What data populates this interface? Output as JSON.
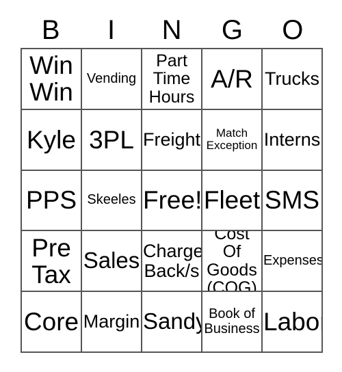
{
  "card": {
    "title": "BINGO Card",
    "header_letters": [
      "B",
      "I",
      "N",
      "G",
      "O"
    ],
    "grid_size": "5x5",
    "border_color": "#555555",
    "text_color": "#000000",
    "background_color": "#ffffff",
    "rows": [
      [
        {
          "text": "Win\nWin",
          "size": "sz-xl"
        },
        {
          "text": "Vending",
          "size": "sz-xs"
        },
        {
          "text": "Part\nTime\nHours",
          "size": "sz-sm"
        },
        {
          "text": "A/R",
          "size": "sz-xl"
        },
        {
          "text": "Trucks",
          "size": "sz-md"
        }
      ],
      [
        {
          "text": "Kyle",
          "size": "sz-xl"
        },
        {
          "text": "3PL",
          "size": "sz-xl"
        },
        {
          "text": "Freight",
          "size": "sz-md"
        },
        {
          "text": "Match\nException",
          "size": "sz-xxs"
        },
        {
          "text": "Interns",
          "size": "sz-md"
        }
      ],
      [
        {
          "text": "PPS",
          "size": "sz-xl"
        },
        {
          "text": "Skeeles",
          "size": "sz-xs"
        },
        {
          "text": "Free!",
          "size": "sz-xl"
        },
        {
          "text": "Fleet",
          "size": "sz-xl"
        },
        {
          "text": "SMS",
          "size": "sz-xl"
        }
      ],
      [
        {
          "text": "Pre\nTax",
          "size": "sz-xl"
        },
        {
          "text": "Sales",
          "size": "sz-lg"
        },
        {
          "text": "Charge\nBack/s",
          "size": "sz-md"
        },
        {
          "text": "Cost Of\nGoods\n(COG)",
          "size": "sz-sm"
        },
        {
          "text": "Expenses",
          "size": "sz-xs"
        }
      ],
      [
        {
          "text": "Core",
          "size": "sz-xl"
        },
        {
          "text": "Margin",
          "size": "sz-md"
        },
        {
          "text": "Sandy",
          "size": "sz-lg"
        },
        {
          "text": "Book of\nBusiness",
          "size": "sz-xs"
        },
        {
          "text": "Labor",
          "size": "sz-xl"
        }
      ]
    ]
  }
}
